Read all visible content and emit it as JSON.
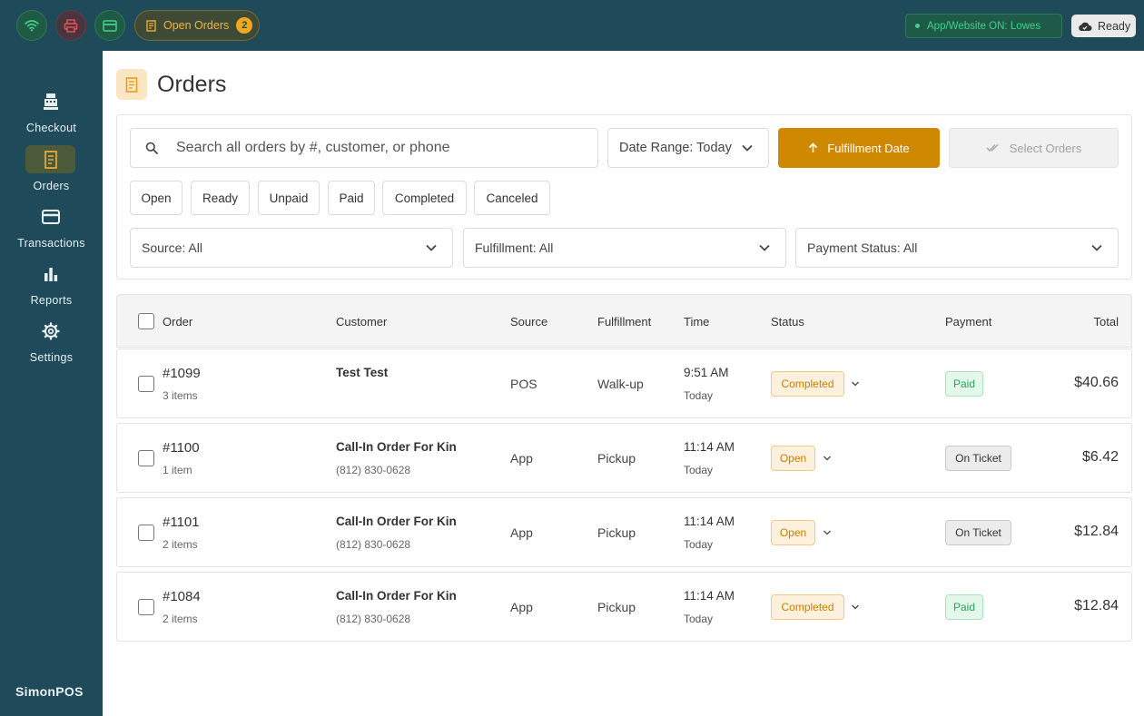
{
  "topbar": {
    "open_orders_label": "Open Orders",
    "open_orders_count": "2",
    "app_status": "App/Website ON: Lowes",
    "ready_label": "Ready"
  },
  "sidebar": {
    "items": [
      {
        "label": "Checkout",
        "icon": "register-icon"
      },
      {
        "label": "Orders",
        "icon": "receipt-icon",
        "active": true
      },
      {
        "label": "Transactions",
        "icon": "card-icon"
      },
      {
        "label": "Reports",
        "icon": "bar-chart-icon"
      },
      {
        "label": "Settings",
        "icon": "gear-icon"
      }
    ],
    "brand": "SimonPOS"
  },
  "page": {
    "title": "Orders"
  },
  "filters": {
    "search_placeholder": "Search all orders by #, customer, or phone",
    "date_range": "Date Range: Today",
    "fulfillment_date_button": "Fulfillment Date",
    "select_orders_button": "Select Orders",
    "chips": [
      "Open",
      "Ready",
      "Unpaid",
      "Paid",
      "Completed",
      "Canceled"
    ],
    "source": "Source: All",
    "fulfillment": "Fulfillment: All",
    "payment_status": "Payment Status: All"
  },
  "table": {
    "headers": {
      "order": "Order",
      "customer": "Customer",
      "source": "Source",
      "fulfillment": "Fulfillment",
      "time": "Time",
      "status": "Status",
      "payment": "Payment",
      "total": "Total"
    },
    "rows": [
      {
        "order": "#1099",
        "items": "3 items",
        "customer": "Test Test",
        "phone": "",
        "source": "POS",
        "fulfillment": "Walk-up",
        "time": "9:51 AM",
        "day": "Today",
        "status": "Completed",
        "payment": "Paid",
        "total": "$40.66"
      },
      {
        "order": "#1100",
        "items": "1 item",
        "customer": "Call-In Order For Kin",
        "phone": "(812) 830-0628",
        "source": "App",
        "fulfillment": "Pickup",
        "time": "11:14 AM",
        "day": "Today",
        "status": "Open",
        "payment": "On Ticket",
        "total": "$6.42"
      },
      {
        "order": "#1101",
        "items": "2 items",
        "customer": "Call-In Order For Kin",
        "phone": "(812) 830-0628",
        "source": "App",
        "fulfillment": "Pickup",
        "time": "11:14 AM",
        "day": "Today",
        "status": "Open",
        "payment": "On Ticket",
        "total": "$12.84"
      },
      {
        "order": "#1084",
        "items": "2 items",
        "customer": "Call-In Order For Kin",
        "phone": "(812) 830-0628",
        "source": "App",
        "fulfillment": "Pickup",
        "time": "11:14 AM",
        "day": "Today",
        "status": "Completed",
        "payment": "Paid",
        "total": "$12.84"
      }
    ]
  },
  "colors": {
    "sidebar_bg": "#1e4a5a",
    "accent": "#cf8900",
    "status_open": "#c97e00",
    "paid_green": "#25a55a"
  }
}
